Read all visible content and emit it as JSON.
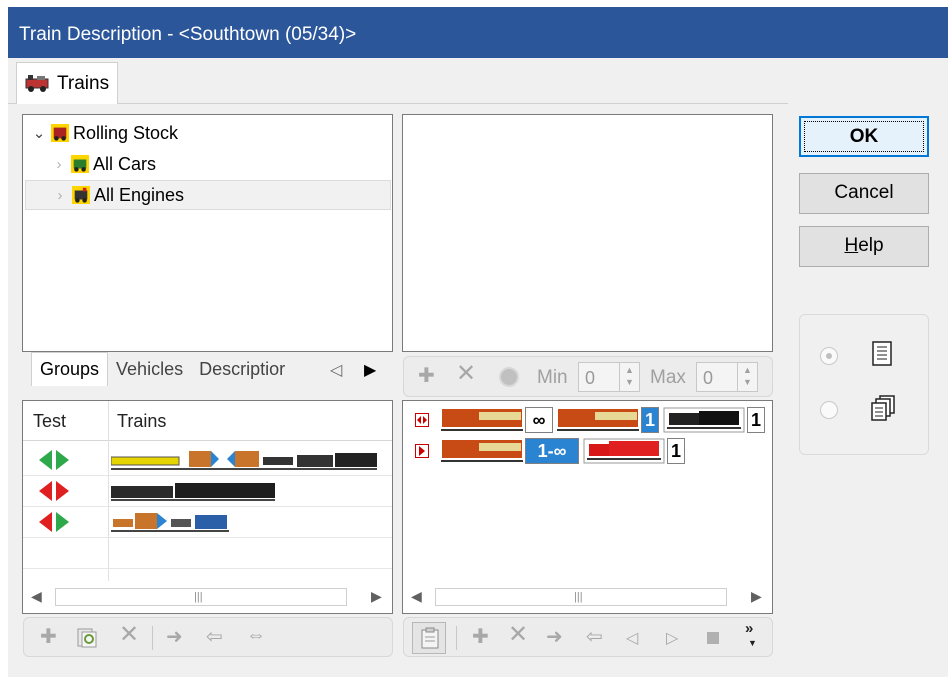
{
  "window": {
    "title": "Train Description - <Southtown (05/34)>"
  },
  "tabs": [
    {
      "label": "Trains",
      "icon": "train-icon"
    }
  ],
  "tree": {
    "root": {
      "label": "Rolling Stock"
    },
    "children": [
      {
        "label": "All Cars"
      },
      {
        "label": "All Engines"
      }
    ]
  },
  "subtabs": {
    "groups": "Groups",
    "vehicles": "Vehicles",
    "description": "Descriptior"
  },
  "grid": {
    "columns": {
      "test": "Test",
      "trains": "Trains"
    },
    "rows": [
      {
        "test_icon": "green-left-right-arrows-icon"
      },
      {
        "test_icon": "red-left-right-arrows-icon"
      },
      {
        "test_icon": "red-green-left-right-arrows-icon"
      }
    ]
  },
  "filters": {
    "min_label": "Min",
    "min_value": "0",
    "max_label": "Max",
    "max_value": "0"
  },
  "consist": {
    "lines": [
      {
        "marker_icon": "two-direction-marker-icon",
        "counts": [
          "∞",
          "1",
          "1"
        ]
      },
      {
        "marker_icon": "one-direction-marker-icon",
        "counts": [
          "1-∞",
          "1"
        ]
      }
    ]
  },
  "buttons": {
    "ok": "OK",
    "cancel": "Cancel",
    "help_prefix": "H",
    "help_rest": "elp"
  },
  "scroll_grip": "|||",
  "colors": {
    "titlebar": "#2b579a",
    "selection_blue": "#2b84d2",
    "default_border": "#0078d7"
  }
}
